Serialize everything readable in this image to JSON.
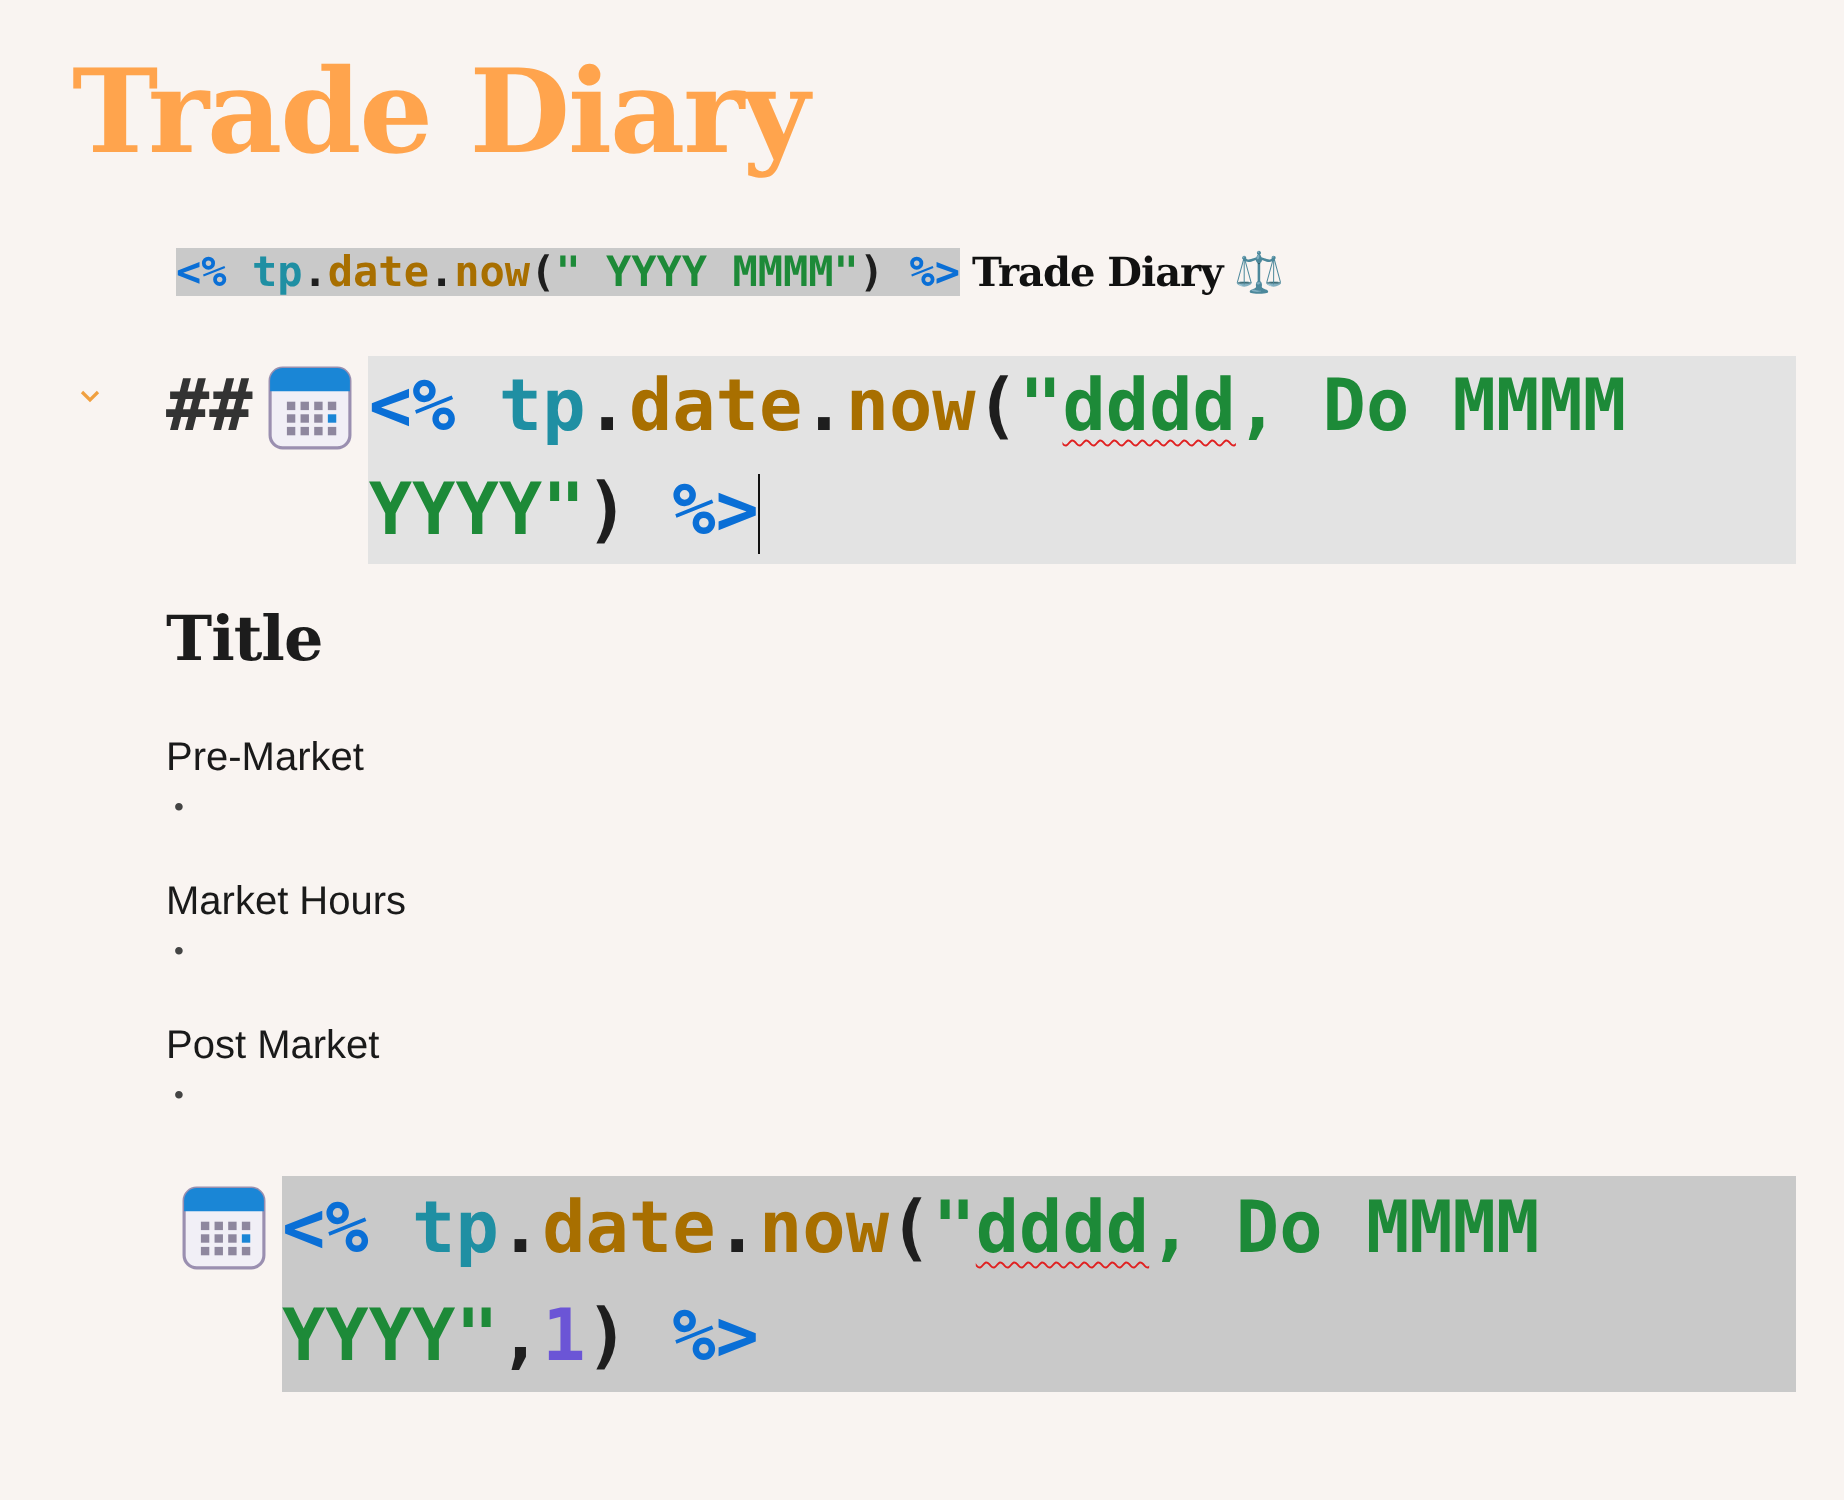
{
  "title": "Trade Diary",
  "blocks": [
    {
      "kind": "template_line",
      "code": [
        {
          "text": "<% ",
          "kind": "delim"
        },
        {
          "text": "tp",
          "kind": "object"
        },
        {
          "text": ".",
          "kind": "punct"
        },
        {
          "text": "date",
          "kind": "method"
        },
        {
          "text": ".",
          "kind": "punct"
        },
        {
          "text": "now",
          "kind": "method"
        },
        {
          "text": "(",
          "kind": "punct"
        },
        {
          "text": "\" YYYY MMMM\"",
          "kind": "string"
        },
        {
          "text": ") ",
          "kind": "punct"
        },
        {
          "text": "%>",
          "kind": "delim"
        }
      ],
      "text": "Trade Diary",
      "emoji": "⚖️"
    },
    {
      "kind": "heading",
      "marker": "##",
      "expanded": true,
      "cursor_at_end": true,
      "code": [
        {
          "text": "<% ",
          "kind": "delim"
        },
        {
          "text": "tp",
          "kind": "object"
        },
        {
          "text": ".",
          "kind": "punct"
        },
        {
          "text": "date",
          "kind": "method"
        },
        {
          "text": ".",
          "kind": "punct"
        },
        {
          "text": "now",
          "kind": "method"
        },
        {
          "text": "(",
          "kind": "punct"
        },
        {
          "text": "\"",
          "kind": "string"
        },
        {
          "text": "dddd",
          "kind": "string",
          "misspelled": true
        },
        {
          "text": ", Do MMMM YYYY\"",
          "kind": "string"
        },
        {
          "text": ") ",
          "kind": "punct"
        },
        {
          "text": "%>",
          "kind": "delim"
        }
      ]
    },
    {
      "kind": "title",
      "text": "Title"
    },
    {
      "kind": "section",
      "text": "Pre-Market",
      "bullet": "•"
    },
    {
      "kind": "section",
      "text": "Market Hours",
      "bullet": "•"
    },
    {
      "kind": "section",
      "text": "Post Market",
      "bullet": "•"
    },
    {
      "kind": "date_line",
      "code": [
        {
          "text": "<% ",
          "kind": "delim"
        },
        {
          "text": "tp",
          "kind": "object"
        },
        {
          "text": ".",
          "kind": "punct"
        },
        {
          "text": "date",
          "kind": "method"
        },
        {
          "text": ".",
          "kind": "punct"
        },
        {
          "text": "now",
          "kind": "method"
        },
        {
          "text": "(",
          "kind": "punct"
        },
        {
          "text": "\"",
          "kind": "string"
        },
        {
          "text": "dddd",
          "kind": "string",
          "misspelled": true
        },
        {
          "text": ", Do MMMM YYYY\"",
          "kind": "string"
        },
        {
          "text": ",",
          "kind": "punct"
        },
        {
          "text": "1",
          "kind": "number"
        },
        {
          "text": ") ",
          "kind": "punct"
        },
        {
          "text": "%>",
          "kind": "delim"
        }
      ]
    }
  ]
}
